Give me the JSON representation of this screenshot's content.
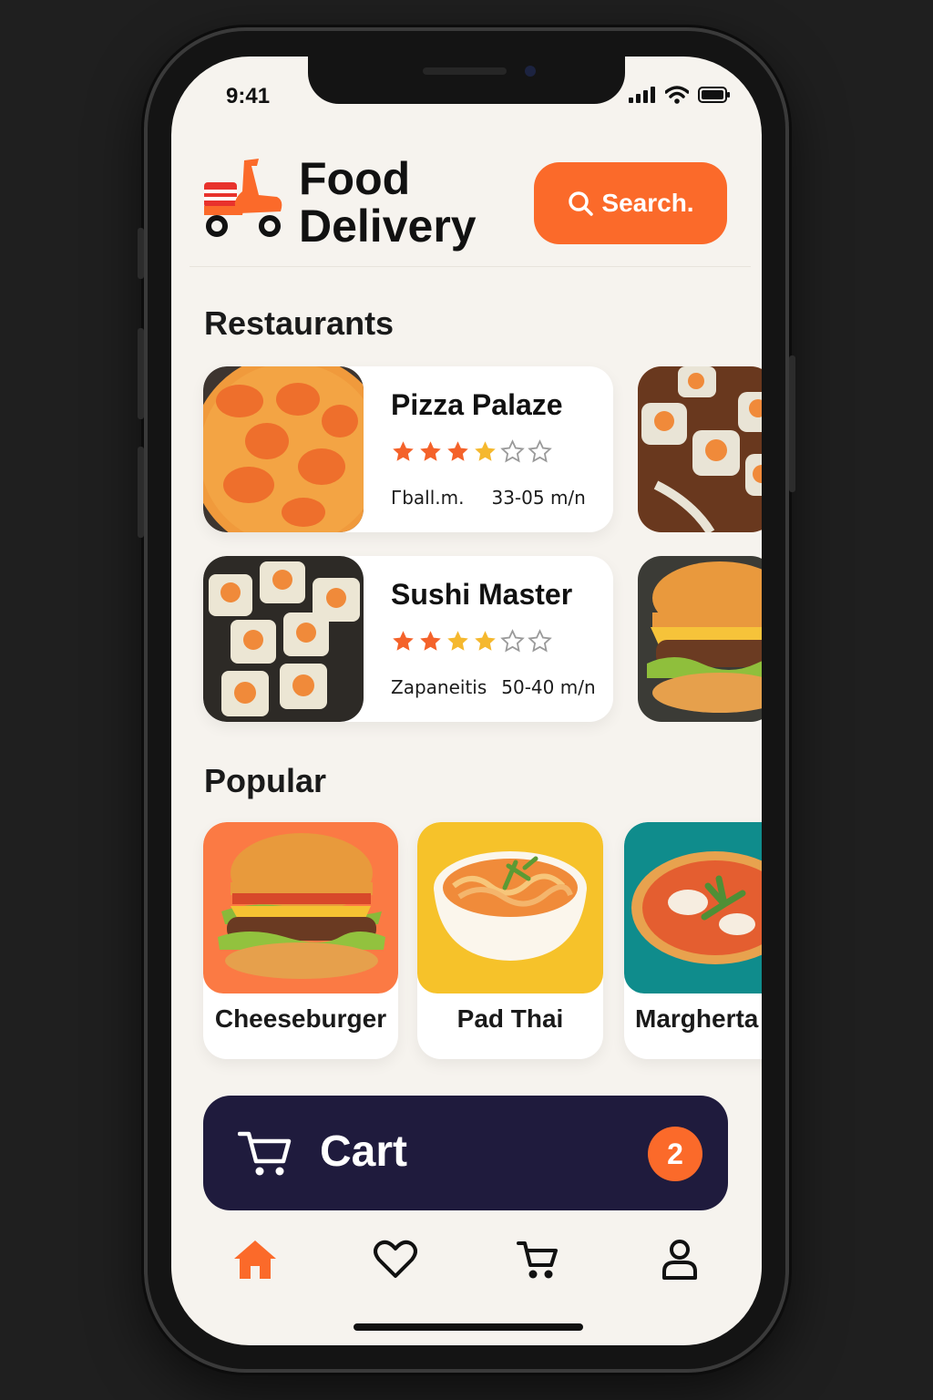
{
  "status_bar": {
    "time": "9:41"
  },
  "header": {
    "title_line1": "Food",
    "title_line2": "Delivery",
    "search_label": "Search.",
    "logo_icon": "scooter-icon"
  },
  "sections": {
    "restaurants": "Restaurants",
    "popular": "Popular"
  },
  "restaurants": [
    {
      "name": "Pizza Palaze",
      "rating": 3.5,
      "max_rating": 5,
      "category": "Гball.m.",
      "delivery_time": "33-05 m/n"
    },
    {
      "name": "Sushi Master",
      "rating": 3.5,
      "max_rating": 5,
      "category": "Zapaneitis",
      "delivery_time": "50-40 m/n"
    }
  ],
  "popular": [
    {
      "name": "Cheeseburger",
      "bg_color": "#fb7a44"
    },
    {
      "name": "Pad Thai",
      "bg_color": "#f6c22a"
    },
    {
      "name": "Marghertа",
      "bg_color": "#0f8c8c"
    }
  ],
  "cart": {
    "label": "Cart",
    "count": "2",
    "icon": "cart-icon"
  },
  "tabbar": [
    {
      "name": "home",
      "icon": "home-icon",
      "active": true
    },
    {
      "name": "favorites",
      "icon": "heart-icon",
      "active": false
    },
    {
      "name": "cart",
      "icon": "cart-icon",
      "active": false
    },
    {
      "name": "profile",
      "icon": "user-icon",
      "active": false
    }
  ],
  "colors": {
    "accent": "#fb6a2a",
    "cart_bar": "#1f1b3d",
    "star_filled": "#f4622a",
    "star_half": "#f5b82e",
    "background": "#f6f3ee"
  }
}
